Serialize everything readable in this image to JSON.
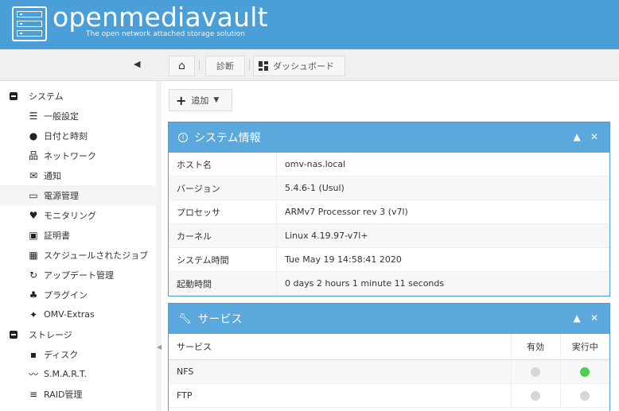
{
  "header": {
    "logo": "openmediavault",
    "subtitle": "The open network attached storage solution"
  },
  "toolbar": {
    "breadcrumb": [
      "診断",
      "ダッシュボード"
    ],
    "add_label": "追加"
  },
  "sidebar": {
    "items": [
      {
        "type": "section",
        "label": "システム"
      },
      {
        "type": "child",
        "label": "一般設定",
        "icon": "sliders-icon"
      },
      {
        "type": "child",
        "label": "日付と時刻",
        "icon": "clock-icon"
      },
      {
        "type": "child",
        "label": "ネットワーク",
        "icon": "network-icon"
      },
      {
        "type": "child",
        "label": "通知",
        "icon": "envelope-icon"
      },
      {
        "type": "child",
        "label": "電源管理",
        "icon": "battery-icon"
      },
      {
        "type": "child",
        "label": "モニタリング",
        "icon": "heartbeat-icon"
      },
      {
        "type": "child",
        "label": "証明書",
        "icon": "certificate-icon"
      },
      {
        "type": "child",
        "label": "スケジュールされたジョブ",
        "icon": "calendar-clock-icon"
      },
      {
        "type": "child",
        "label": "アップデート管理",
        "icon": "refresh-icon"
      },
      {
        "type": "child",
        "label": "プラグイン",
        "icon": "puzzle-icon"
      },
      {
        "type": "child",
        "label": "OMV-Extras",
        "icon": "satellite-icon"
      },
      {
        "type": "section",
        "label": "ストレージ"
      },
      {
        "type": "child",
        "label": "ディスク",
        "icon": "disk-icon"
      },
      {
        "type": "child",
        "label": "S.M.A.R.T.",
        "icon": "pulse-icon"
      },
      {
        "type": "child",
        "label": "RAID管理",
        "icon": "database-icon"
      }
    ]
  },
  "system_info": {
    "title": "システム情報",
    "rows": [
      {
        "key": "ホスト名",
        "value": "omv-nas.local"
      },
      {
        "key": "バージョン",
        "value": "5.4.6-1 (Usul)"
      },
      {
        "key": "プロセッサ",
        "value": "ARMv7 Processor rev 3 (v7l)"
      },
      {
        "key": "カーネル",
        "value": "Linux 4.19.97-v7l+"
      },
      {
        "key": "システム時間",
        "value": "Tue May 19 14:58:41 2020"
      },
      {
        "key": "起動時間",
        "value": "0 days 2 hours 1 minute 11 seconds"
      }
    ]
  },
  "services": {
    "title": "サービス",
    "columns": [
      "サービス",
      "有効",
      "実行中"
    ],
    "rows": [
      {
        "name": "NFS",
        "enabled": false,
        "running": true
      },
      {
        "name": "FTP",
        "enabled": false,
        "running": false
      }
    ]
  },
  "colors": {
    "header_bg": "#4a9fd8",
    "panel_head": "#5ba8dd",
    "status_running": "#4ad04a",
    "status_off": "#d6d6d6"
  }
}
